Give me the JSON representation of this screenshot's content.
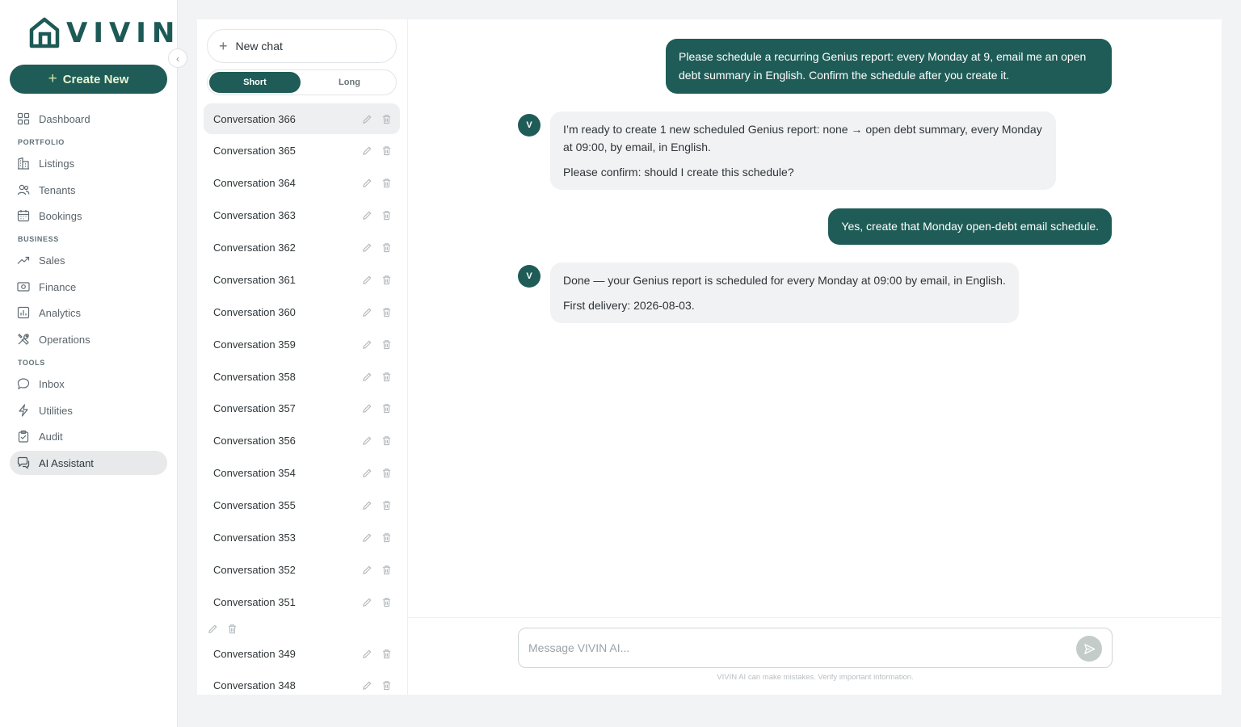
{
  "brand": {
    "name": "VIVIN",
    "accent": "#1f5c57"
  },
  "sidebar": {
    "create_label": "Create New",
    "collapse_icon": "chevron-left-icon",
    "items": [
      {
        "label": "Dashboard",
        "icon": "dashboard-icon"
      },
      {
        "label": "Listings",
        "icon": "building-icon"
      },
      {
        "label": "Tenants",
        "icon": "users-icon"
      },
      {
        "label": "Bookings",
        "icon": "calendar-icon"
      },
      {
        "label": "Sales",
        "icon": "trend-up-icon"
      },
      {
        "label": "Finance",
        "icon": "banknote-icon"
      },
      {
        "label": "Analytics",
        "icon": "bar-chart-icon"
      },
      {
        "label": "Operations",
        "icon": "tools-icon"
      },
      {
        "label": "Inbox",
        "icon": "chat-bubble-icon"
      },
      {
        "label": "Utilities",
        "icon": "lightning-icon"
      },
      {
        "label": "Audit",
        "icon": "clipboard-icon"
      },
      {
        "label": "AI Assistant",
        "icon": "ai-chat-icon",
        "active": true
      }
    ],
    "sections": {
      "portfolio": "PORTFOLIO",
      "business": "BUSINESS",
      "tools": "TOOLS"
    }
  },
  "conversations": {
    "new_chat_label": "New chat",
    "modes": {
      "short": "Short",
      "long": "Long",
      "selected": "Short"
    },
    "items": [
      {
        "label": "Conversation 366",
        "active": true
      },
      {
        "label": "Conversation 365"
      },
      {
        "label": "Conversation 364"
      },
      {
        "label": "Conversation 363"
      },
      {
        "label": "Conversation 362"
      },
      {
        "label": "Conversation 361"
      },
      {
        "label": "Conversation 360"
      },
      {
        "label": "Conversation 359"
      },
      {
        "label": "Conversation 358"
      },
      {
        "label": "Conversation 357"
      },
      {
        "label": "Conversation 356"
      },
      {
        "label": "Conversation 354"
      },
      {
        "label": "Conversation 355"
      },
      {
        "label": "Conversation 353"
      },
      {
        "label": "Conversation 352"
      },
      {
        "label": "Conversation 351"
      },
      {
        "label": "Conversation 349"
      },
      {
        "label": "Conversation 348"
      }
    ]
  },
  "chat": {
    "messages": [
      {
        "role": "user",
        "text": "Please schedule a recurring Genius report: every Monday at 9, email me an open debt summary in English. Confirm the schedule after you create it."
      },
      {
        "role": "assistant",
        "avatar": "V",
        "paragraphs": [
          "I’m ready to create 1 new scheduled Genius report: none → open debt summary, every Monday at 09:00, by email, in English.",
          "Please confirm: should I create this schedule?"
        ]
      },
      {
        "role": "user",
        "text": "Yes, create that Monday open-debt email schedule."
      },
      {
        "role": "assistant",
        "avatar": "V",
        "paragraphs": [
          "Done — your Genius report is scheduled for every Monday at 09:00 by email, in English.",
          "First delivery: 2026-08-03."
        ]
      }
    ],
    "composer": {
      "placeholder": "Message VIVIN AI...",
      "send_icon": "send-icon"
    },
    "disclaimer": "VIVIN AI can make mistakes. Verify important information."
  }
}
